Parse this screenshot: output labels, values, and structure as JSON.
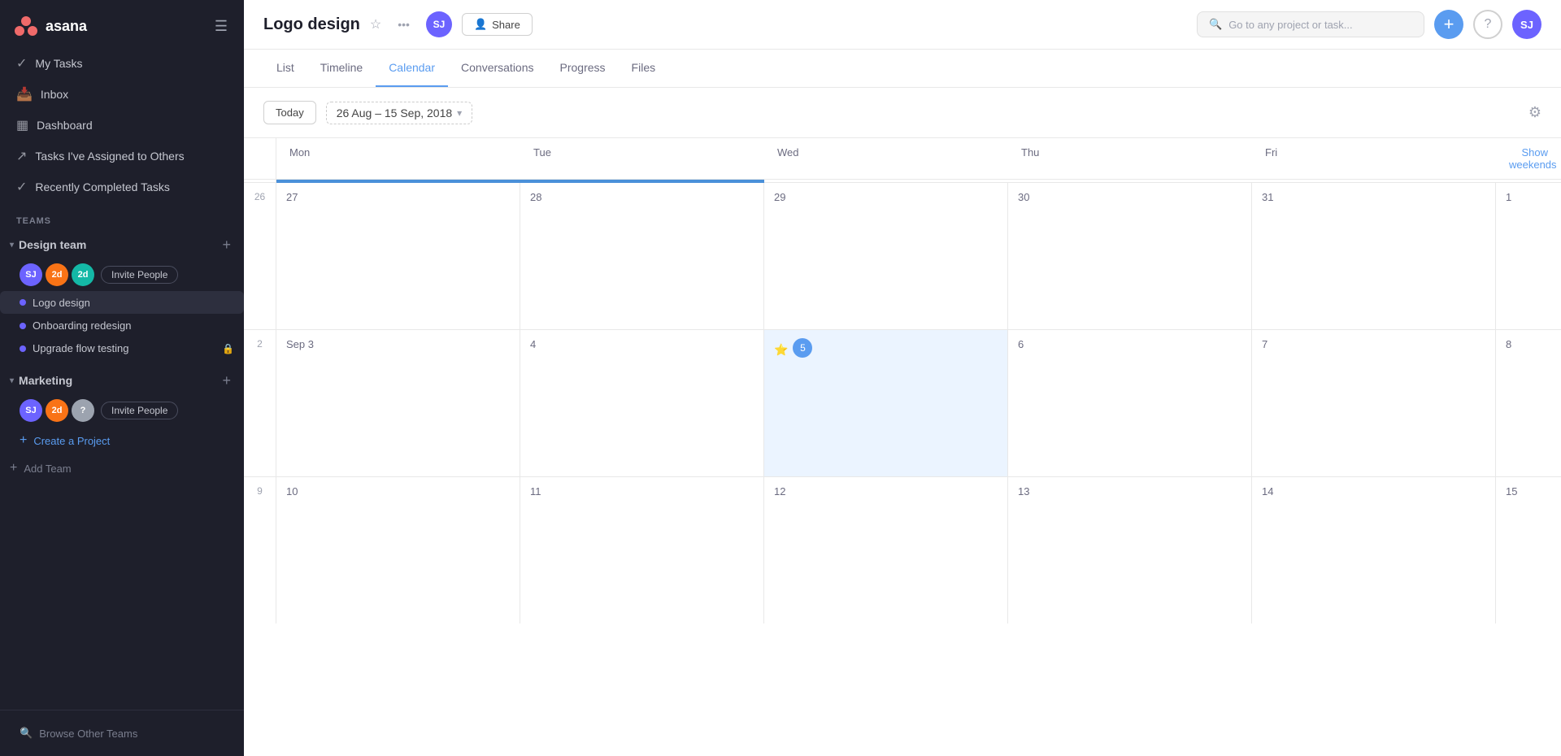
{
  "sidebar": {
    "logo_text": "asana",
    "nav_items": [
      {
        "id": "my-tasks",
        "label": "My Tasks",
        "icon": "✓"
      },
      {
        "id": "inbox",
        "label": "Inbox",
        "icon": "📥"
      },
      {
        "id": "dashboard",
        "label": "Dashboard",
        "icon": "📊"
      },
      {
        "id": "tasks-assigned",
        "label": "Tasks I've Assigned to Others",
        "icon": "↗"
      },
      {
        "id": "recently-completed",
        "label": "Recently Completed Tasks",
        "icon": "✓"
      }
    ],
    "teams_label": "Teams",
    "teams": [
      {
        "id": "design-team",
        "name": "Design team",
        "expanded": true,
        "members": [
          "SJ",
          "2d",
          "2d"
        ],
        "invite_label": "Invite People",
        "projects": [
          {
            "id": "logo-design",
            "label": "Logo design",
            "active": true,
            "locked": false
          },
          {
            "id": "onboarding-redesign",
            "label": "Onboarding redesign",
            "active": false,
            "locked": false
          },
          {
            "id": "upgrade-flow",
            "label": "Upgrade flow testing",
            "active": false,
            "locked": true
          }
        ]
      },
      {
        "id": "marketing",
        "name": "Marketing",
        "expanded": true,
        "members": [
          "SJ",
          "2d",
          "?"
        ],
        "invite_label": "Invite People",
        "projects": []
      }
    ],
    "create_project_label": "Create a Project",
    "add_team_label": "Add Team",
    "browse_teams_label": "Browse Other Teams"
  },
  "header": {
    "project_title": "Logo design",
    "user_initials": "SJ",
    "share_label": "Share",
    "search_placeholder": "Go to any project or task..."
  },
  "tabs": [
    {
      "id": "list",
      "label": "List",
      "active": false
    },
    {
      "id": "timeline",
      "label": "Timeline",
      "active": false
    },
    {
      "id": "calendar",
      "label": "Calendar",
      "active": true
    },
    {
      "id": "conversations",
      "label": "Conversations",
      "active": false
    },
    {
      "id": "progress",
      "label": "Progress",
      "active": false
    },
    {
      "id": "files",
      "label": "Files",
      "active": false
    }
  ],
  "calendar": {
    "today_label": "Today",
    "date_range": "26 Aug – 15 Sep, 2018",
    "show_weekends_label": "Show weekends",
    "day_headers": [
      "Mon",
      "Tue",
      "Wed",
      "Thu",
      "Fri"
    ],
    "weeks": [
      {
        "week_num": "26",
        "days": [
          {
            "date": "27",
            "today": false
          },
          {
            "date": "28",
            "today": false
          },
          {
            "date": "29",
            "today": false
          },
          {
            "date": "30",
            "today": false
          },
          {
            "date": "31",
            "today": false
          }
        ]
      },
      {
        "week_num": "2",
        "days": [
          {
            "date": "Sep 3",
            "today": false
          },
          {
            "date": "4",
            "today": false
          },
          {
            "date": "5",
            "today": true
          },
          {
            "date": "6",
            "today": false
          },
          {
            "date": "7",
            "today": false
          }
        ],
        "has_weekend_col": "8"
      },
      {
        "week_num": "9",
        "days": [
          {
            "date": "10",
            "today": false
          },
          {
            "date": "11",
            "today": false
          },
          {
            "date": "12",
            "today": false
          },
          {
            "date": "13",
            "today": false
          },
          {
            "date": "14",
            "today": false
          }
        ],
        "has_weekend_col": "15"
      }
    ]
  }
}
